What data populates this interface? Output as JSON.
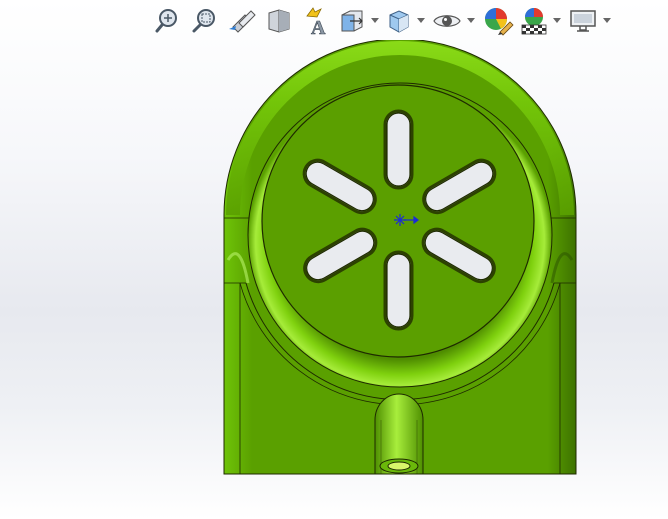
{
  "viewport": {
    "model_color": "#5aa000",
    "model_highlight": "#8fe11a",
    "edge_color": "#1e2a00",
    "slot_fill": "#e9ebef",
    "triad_color": "#1a2bd6"
  },
  "toolbar": {
    "items": [
      {
        "icon": "zoom-to-fit-icon",
        "has_dropdown": false
      },
      {
        "icon": "zoom-to-area-icon",
        "has_dropdown": false
      },
      {
        "icon": "previous-view-icon",
        "has_dropdown": false
      },
      {
        "icon": "section-view-icon",
        "has_dropdown": false
      },
      {
        "icon": "dynamic-annotation-views-icon",
        "has_dropdown": false
      },
      {
        "icon": "view-orientation-icon",
        "has_dropdown": true
      },
      {
        "icon": "display-style-icon",
        "has_dropdown": true
      },
      {
        "icon": "hide-show-items-icon",
        "has_dropdown": true
      },
      {
        "icon": "edit-appearance-icon",
        "has_dropdown": false
      },
      {
        "icon": "apply-scene-icon",
        "has_dropdown": true
      },
      {
        "icon": "view-settings-icon",
        "has_dropdown": true
      }
    ]
  }
}
